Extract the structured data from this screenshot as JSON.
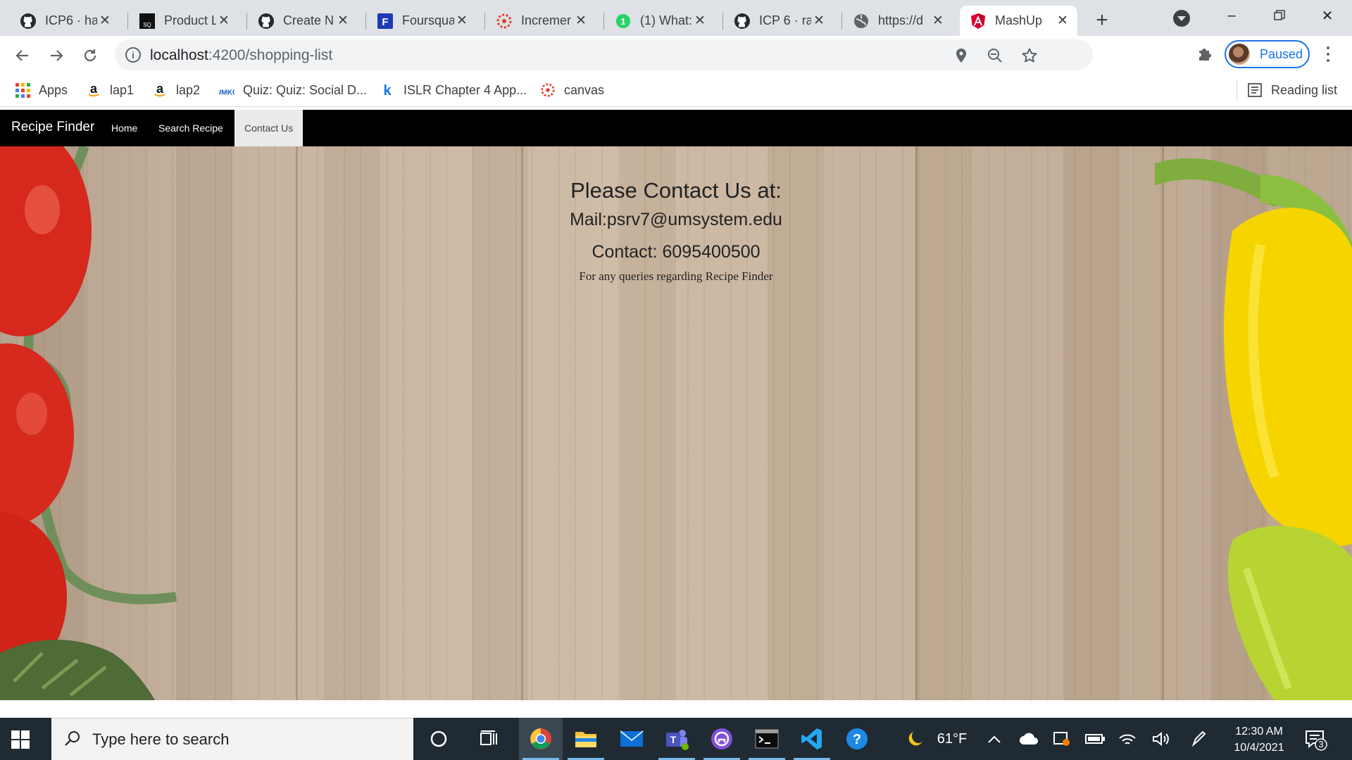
{
  "browser": {
    "tabs": [
      {
        "title": "ICP6 · ha",
        "icon": "github-icon"
      },
      {
        "title": "Product L",
        "icon": "sq-icon"
      },
      {
        "title": "Create N",
        "icon": "github-icon"
      },
      {
        "title": "Foursqua",
        "icon": "foursquare-icon"
      },
      {
        "title": "Incremer",
        "icon": "canvas-icon"
      },
      {
        "title": "(1) What:",
        "icon": "whatsapp-icon"
      },
      {
        "title": "ICP 6 · ra",
        "icon": "github-icon"
      },
      {
        "title": "https://d",
        "icon": "globe-icon"
      },
      {
        "title": "MashUp",
        "icon": "angular-icon",
        "active": true
      }
    ],
    "new_tab_label": "+",
    "url_host": "localhost",
    "url_path": ":4200/shopping-list",
    "profile_label": "Paused",
    "bookmarks": [
      {
        "label": "Apps",
        "icon": "apps-grid-icon"
      },
      {
        "label": "lap1",
        "icon": "amazon-icon"
      },
      {
        "label": "lap2",
        "icon": "amazon-icon"
      },
      {
        "label": "Quiz: Quiz: Social D...",
        "icon": "umkc-icon"
      },
      {
        "label": "ISLR Chapter 4 App...",
        "icon": "k-icon"
      },
      {
        "label": "canvas",
        "icon": "canvas-icon"
      }
    ],
    "reading_list_label": "Reading list"
  },
  "app": {
    "brand": "Recipe Finder",
    "nav": [
      {
        "label": "Home"
      },
      {
        "label": "Search Recipe"
      },
      {
        "label": "Contact Us",
        "active": true
      }
    ],
    "contact": {
      "title": "Please Contact Us at:",
      "mail": "Mail:psrv7@umsystem.edu",
      "phone": "Contact: 6095400500",
      "note": "For any queries regarding Recipe Finder"
    }
  },
  "taskbar": {
    "search_placeholder": "Type here to search",
    "weather": "61°F",
    "time": "12:30 AM",
    "date": "10/4/2021",
    "notification_count": "3"
  },
  "colors": {
    "nav_bg": "#000000",
    "nav_active_bg": "#eaeaea",
    "chrome_accent": "#1a73e8",
    "taskbar_bg": "#1f2a33"
  }
}
